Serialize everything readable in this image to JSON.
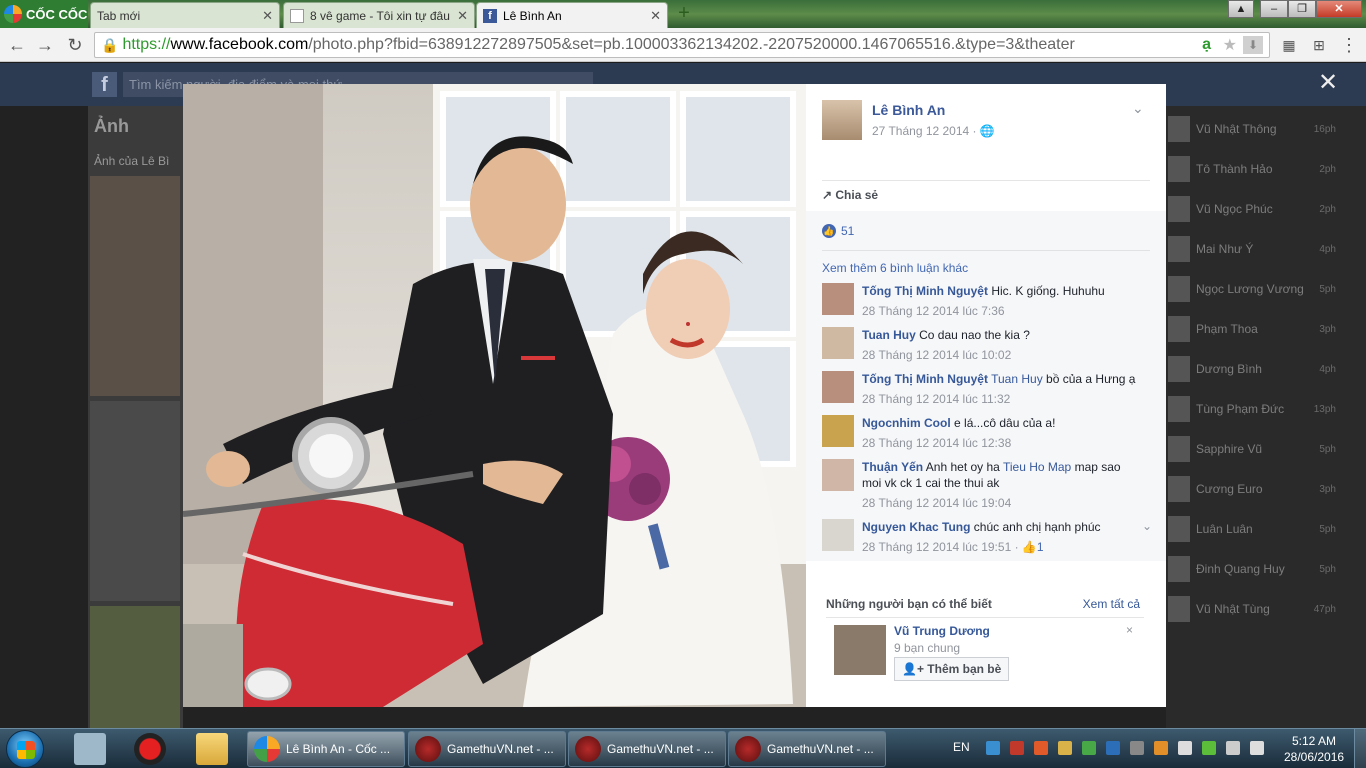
{
  "browser": {
    "brand": "CỐC CỐC",
    "tabs": [
      {
        "label": "Tab mới"
      },
      {
        "label": "8 vê game - Tôi xin tự đâu"
      },
      {
        "label": "Lê Bình An"
      }
    ],
    "url_https": "https://",
    "url_domain": "www.facebook.com",
    "url_rest": "/photo.php?fbid=638912272897505&set=pb.100003362134202.-2207520000.1467065516.&type=3&theater"
  },
  "background": {
    "search_placeholder": "Tìm kiếm người, địa điểm và mọi thứ",
    "section_title": "Ảnh",
    "section_sub": "Ảnh của Lê Bì",
    "chat_list": [
      {
        "name": "Vũ Nhật Thông",
        "time": "16ph"
      },
      {
        "name": "Tô Thành Hảo",
        "time": "2ph"
      },
      {
        "name": "Vũ Ngọc Phúc",
        "time": "2ph"
      },
      {
        "name": "Mai Như Ý",
        "time": "4ph"
      },
      {
        "name": "Ngọc Lương Vương",
        "time": "5ph"
      },
      {
        "name": "Phạm Thoa",
        "time": "3ph"
      },
      {
        "name": "Dương Bình",
        "time": "4ph"
      },
      {
        "name": "Tùng Phạm Đức",
        "time": "13ph"
      },
      {
        "name": "Sapphire Vũ",
        "time": "5ph"
      },
      {
        "name": "Cương Euro",
        "time": "3ph"
      },
      {
        "name": "Luân Luân",
        "time": "5ph"
      },
      {
        "name": "Đinh Quang Huy",
        "time": "5ph"
      },
      {
        "name": "Vũ Nhật Tùng",
        "time": "47ph"
      }
    ]
  },
  "post": {
    "author": "Lê Bình An",
    "date": "27 Tháng 12 2014 ·",
    "share_label": "Chia sẻ",
    "likes": "51",
    "more_comments": "Xem thêm 6 bình luận khác",
    "comments": [
      {
        "author": "Tống Thị Minh Nguyệt",
        "text": "Hic. K giống. Huhuhu",
        "link": "",
        "text2": "",
        "time": "28 Tháng 12 2014 lúc 7:36"
      },
      {
        "author": "Tuan Huy",
        "text": "Co dau nao the kia ?",
        "link": "",
        "text2": "",
        "time": "28 Tháng 12 2014 lúc 10:02"
      },
      {
        "author": "Tống Thị Minh Nguyệt",
        "text": "",
        "link": "Tuan Huy",
        "text2": "bồ của a Hưng ạ",
        "time": "28 Tháng 12 2014 lúc 11:32"
      },
      {
        "author": "Ngocnhim Cool",
        "text": "e lá...cô dâu của a!",
        "link": "",
        "text2": "",
        "time": "28 Tháng 12 2014 lúc 12:38"
      },
      {
        "author": "Thuận Yến",
        "text": "Anh het oy ha",
        "link": "Tieu Ho Map",
        "text2": "map sao moi vk ck 1 cai the thui ak",
        "time": "28 Tháng 12 2014 lúc 19:04"
      },
      {
        "author": "Nguyen Khac Tung",
        "text": "chúc anh chị hạnh phúc",
        "link": "",
        "text2": "",
        "time": "28 Tháng 12 2014 lúc 19:51 ·",
        "likes": "1"
      }
    ],
    "pymk": {
      "heading": "Những người bạn có thể biết",
      "see_all": "Xem tất cả",
      "name": "Vũ Trung Dương",
      "mutual": "9 bạn chung",
      "add_button": "Thêm bạn bè",
      "close": "×"
    }
  },
  "taskbar": {
    "tasks": [
      {
        "label": "Lê Bình An - Cốc ..."
      },
      {
        "label": "GamethuVN.net - ..."
      },
      {
        "label": "GamethuVN.net - ..."
      },
      {
        "label": "GamethuVN.net - ..."
      }
    ],
    "lang": "EN",
    "time": "5:12 AM",
    "date": "28/06/2016"
  }
}
